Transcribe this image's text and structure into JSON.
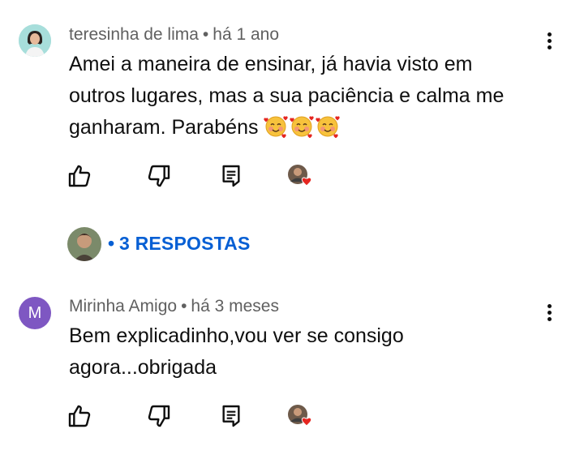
{
  "comments": [
    {
      "author": "teresinha de lima",
      "separator": "•",
      "time": "há 1 ano",
      "text": "Amei a maneira de ensinar,  já havia visto em outros lugares, mas a sua paciência e calma me ganharam. Parabéns",
      "line1": "Amei a maneira de ensinar,  já havia visto em",
      "line2": "outros lugares, mas a sua paciência e calma me",
      "line3": "ganharam. Parabéns",
      "emojis": [
        "smiling-face-with-hearts",
        "smiling-face-with-hearts",
        "smiling-face-with-hearts"
      ],
      "replies_label": "3 RESPOSTAS",
      "replies_bullet": "•"
    },
    {
      "author": "Mirinha Amigo",
      "separator": "•",
      "time": "há 3 meses",
      "avatar_letter": "M",
      "avatar_color": "#7e57c2",
      "line1": "Bem explicadinho,vou ver se consigo",
      "line2": "agora...obrigada"
    }
  ],
  "icons": {
    "like": "thumb-up-icon",
    "dislike": "thumb-down-icon",
    "reply": "reply-icon",
    "creator_heart": "creator-heart-icon",
    "menu": "more-vert-icon"
  },
  "colors": {
    "link_blue": "#065fd4",
    "meta_gray": "#606060",
    "heart_red": "#e52620"
  }
}
